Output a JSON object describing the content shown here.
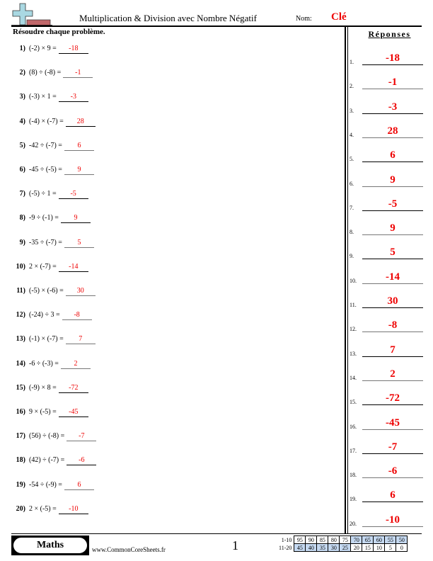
{
  "header": {
    "title": "Multiplication & Division avec Nombre Négatif",
    "name_label": "Nom:",
    "name_value": "Clé",
    "logo_icon": "plus-and-minus-icon"
  },
  "instructions": "Résoudre chaque problème.",
  "answers_heading": "Réponses",
  "problems": [
    {
      "num": "1)",
      "expr": "(-2) × 9 =",
      "answer": "-18"
    },
    {
      "num": "2)",
      "expr": "(8) ÷ (-8) =",
      "answer": "-1"
    },
    {
      "num": "3)",
      "expr": "(-3) × 1 =",
      "answer": "-3"
    },
    {
      "num": "4)",
      "expr": "(-4) × (-7) =",
      "answer": "28"
    },
    {
      "num": "5)",
      "expr": "-42 ÷ (-7) =",
      "answer": "6"
    },
    {
      "num": "6)",
      "expr": "-45 ÷ (-5) =",
      "answer": "9"
    },
    {
      "num": "7)",
      "expr": "(-5) ÷ 1 =",
      "answer": "-5"
    },
    {
      "num": "8)",
      "expr": "-9 ÷ (-1) =",
      "answer": "9"
    },
    {
      "num": "9)",
      "expr": "-35 ÷ (-7) =",
      "answer": "5"
    },
    {
      "num": "10)",
      "expr": "2 × (-7) =",
      "answer": "-14"
    },
    {
      "num": "11)",
      "expr": "(-5) × (-6) =",
      "answer": "30"
    },
    {
      "num": "12)",
      "expr": "(-24) ÷ 3 =",
      "answer": "-8"
    },
    {
      "num": "13)",
      "expr": "(-1) × (-7) =",
      "answer": "7"
    },
    {
      "num": "14)",
      "expr": "-6 ÷ (-3) =",
      "answer": "2"
    },
    {
      "num": "15)",
      "expr": "(-9) × 8 =",
      "answer": "-72"
    },
    {
      "num": "16)",
      "expr": "9 × (-5) =",
      "answer": "-45"
    },
    {
      "num": "17)",
      "expr": "(56) ÷ (-8) =",
      "answer": "-7"
    },
    {
      "num": "18)",
      "expr": "(42) ÷ (-7) =",
      "answer": "-6"
    },
    {
      "num": "19)",
      "expr": "-54 ÷ (-9) =",
      "answer": "6"
    },
    {
      "num": "20)",
      "expr": "2 × (-5) =",
      "answer": "-10"
    }
  ],
  "answer_key": [
    {
      "idx": "1.",
      "value": "-18"
    },
    {
      "idx": "2.",
      "value": "-1"
    },
    {
      "idx": "3.",
      "value": "-3"
    },
    {
      "idx": "4.",
      "value": "28"
    },
    {
      "idx": "5.",
      "value": "6"
    },
    {
      "idx": "6.",
      "value": "9"
    },
    {
      "idx": "7.",
      "value": "-5"
    },
    {
      "idx": "8.",
      "value": "9"
    },
    {
      "idx": "9.",
      "value": "5"
    },
    {
      "idx": "10.",
      "value": "-14"
    },
    {
      "idx": "11.",
      "value": "30"
    },
    {
      "idx": "12.",
      "value": "-8"
    },
    {
      "idx": "13.",
      "value": "7"
    },
    {
      "idx": "14.",
      "value": "2"
    },
    {
      "idx": "15.",
      "value": "-72"
    },
    {
      "idx": "16.",
      "value": "-45"
    },
    {
      "idx": "17.",
      "value": "-7"
    },
    {
      "idx": "18.",
      "value": "-6"
    },
    {
      "idx": "19.",
      "value": "6"
    },
    {
      "idx": "20.",
      "value": "-10"
    }
  ],
  "footer": {
    "subject": "Maths",
    "website": "www.CommonCoreSheets.fr",
    "page_number": "1",
    "score_table": {
      "rows": [
        {
          "label": "1-10",
          "values": [
            "95",
            "90",
            "85",
            "80",
            "75",
            "70",
            "65",
            "60",
            "55",
            "50"
          ],
          "highlight": [
            false,
            false,
            false,
            false,
            false,
            true,
            true,
            true,
            true,
            true
          ]
        },
        {
          "label": "11-20",
          "values": [
            "45",
            "40",
            "35",
            "30",
            "25",
            "20",
            "15",
            "10",
            "5",
            "0"
          ],
          "highlight": [
            true,
            true,
            true,
            true,
            true,
            false,
            false,
            false,
            false,
            false
          ]
        }
      ]
    }
  },
  "colors": {
    "answer_red": "#ee0000",
    "score_highlight": "#c5d9f1"
  }
}
